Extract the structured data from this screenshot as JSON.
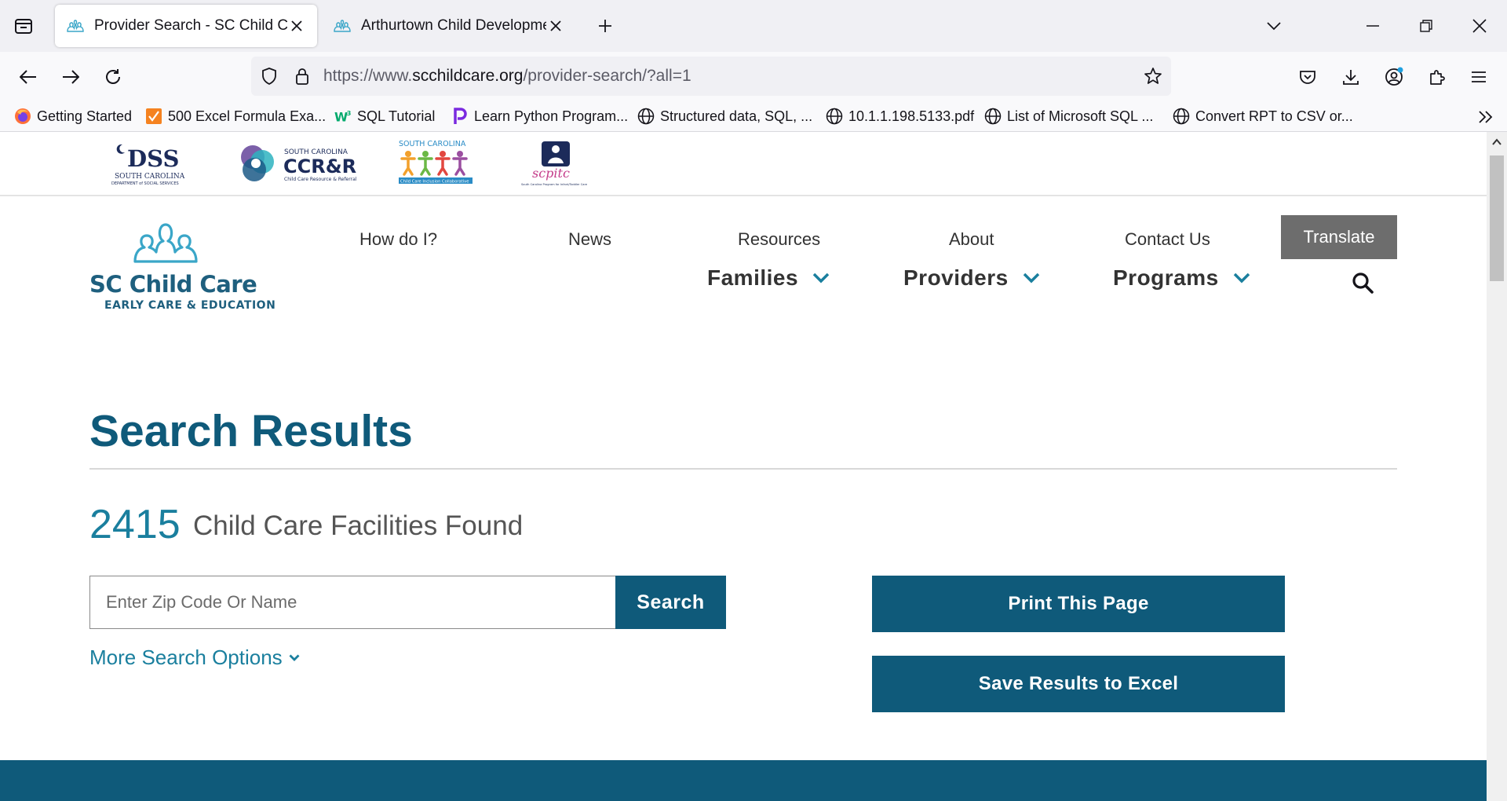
{
  "browser": {
    "tabs": [
      {
        "title": "Provider Search - SC Child Care",
        "active": true
      },
      {
        "title": "Arthurtown Child Development",
        "active": false
      }
    ],
    "url": {
      "prefix": "https://www.",
      "host": "scchildcare.org",
      "path": "/provider-search/?all=1"
    },
    "bookmarks": [
      {
        "label": "Getting Started",
        "icon": "firefox-icon"
      },
      {
        "label": "500 Excel Formula Exa...",
        "icon": "orange-bookmark-icon"
      },
      {
        "label": "SQL Tutorial",
        "icon": "w3-icon"
      },
      {
        "label": "Learn Python Program...",
        "icon": "python-p-icon"
      },
      {
        "label": "Structured data, SQL, ...",
        "icon": "globe-icon"
      },
      {
        "label": "10.1.1.198.5133.pdf",
        "icon": "globe-icon"
      },
      {
        "label": "List of Microsoft SQL ...",
        "icon": "globe-icon"
      },
      {
        "label": "Convert RPT to CSV or...",
        "icon": "globe-icon"
      }
    ]
  },
  "partners": {
    "dss": {
      "main": "DSS",
      "sub1": "SOUTH CAROLINA",
      "sub2": "DEPARTMENT of SOCIAL SERVICES"
    },
    "ccrr": {
      "top": "SOUTH CAROLINA",
      "main": "CCR&R",
      "sub": "Child Care Resource & Referral"
    },
    "inclusion": {
      "top": "SOUTH CAROLINA",
      "sub": "Child Care Inclusion Collaborative"
    },
    "scpitc": {
      "main": "scpitc",
      "sub": "South Carolina Program for Infant/Toddler Care"
    }
  },
  "site": {
    "logo_name": "SC Child Care",
    "logo_tagline": "EARLY CARE & EDUCATION",
    "topnav": [
      "How do I?",
      "News",
      "Resources",
      "About",
      "Contact Us"
    ],
    "translate": "Translate",
    "mainnav": [
      "Families",
      "Providers",
      "Programs"
    ]
  },
  "results": {
    "title": "Search Results",
    "count": "2415",
    "count_label": "Child Care Facilities Found",
    "search_placeholder": "Enter Zip Code Or Name",
    "search_button": "Search",
    "more_options": "More Search Options",
    "print_button": "Print This Page",
    "excel_button": "Save Results to Excel"
  },
  "colors": {
    "brand_dark": "#0f5a7a",
    "brand_teal": "#1a7f9e",
    "translate_gray": "#6d6d6d"
  }
}
